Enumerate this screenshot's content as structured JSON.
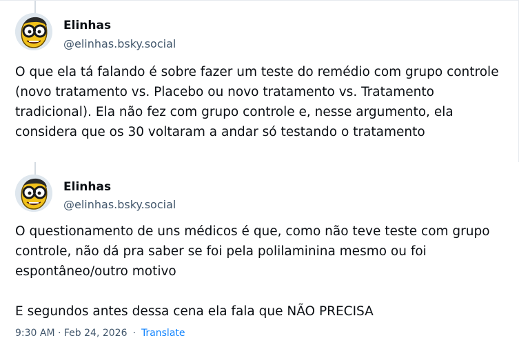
{
  "posts": [
    {
      "author": {
        "name": "Elinhas",
        "handle": "@elinhas.bsky.social",
        "avatar": "cartoon-character-with-glasses-icon"
      },
      "text": "O que ela tá falando é sobre fazer um teste do remédio com grupo controle (novo tratamento vs. Placebo ou novo tratamento vs. Tratamento tradicional). Ela não fez com grupo controle e, nesse argumento, ela considera que os 30 voltaram a andar só testando o tratamento"
    },
    {
      "author": {
        "name": "Elinhas",
        "handle": "@elinhas.bsky.social",
        "avatar": "cartoon-character-with-glasses-icon"
      },
      "text": "O questionamento de uns médicos é que, como não teve teste com grupo controle, não dá pra saber se foi pela polilaminina mesmo ou foi espontâneo/outro motivo\n\nE segundos antes dessa cena ela fala que NÃO PRECISA",
      "timestamp": "9:30 AM · Feb 24, 2026",
      "separator": "·",
      "translate_label": "Translate"
    }
  ],
  "colors": {
    "text": "#0b0f14",
    "secondary": "#42576c",
    "link": "#1083fe",
    "thread_line": "#d4dbe2",
    "border": "#e6e9ee"
  }
}
